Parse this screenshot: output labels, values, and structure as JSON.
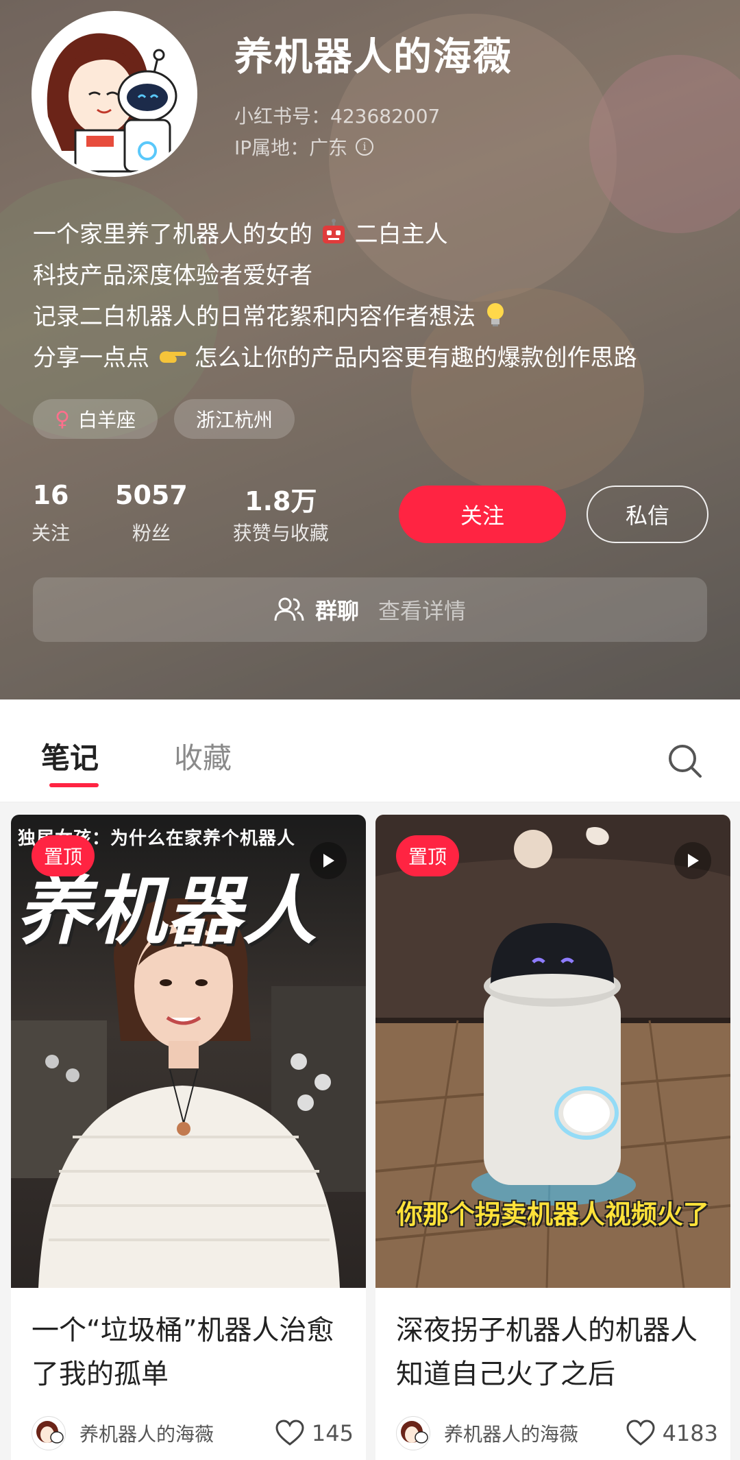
{
  "profile": {
    "nickname": "养机器人的海薇",
    "red_id": "小红书号：423682007",
    "ip_location": "IP属地：广东",
    "bio": [
      "一个家里养了机器人的女的",
      "二白主人",
      "科技产品深度体验者爱好者",
      "记录二白机器人的日常花絮和内容作者想法",
      "分享一点点",
      "怎么让你的产品内容更有趣的爆款创作思路"
    ],
    "tags": [
      "白羊座",
      "浙江杭州"
    ],
    "stats": [
      {
        "value": "16",
        "label": "关注"
      },
      {
        "value": "5057",
        "label": "粉丝"
      },
      {
        "value": "1.8万",
        "label": "获赞与收藏"
      }
    ],
    "follow_label": "关注",
    "message_label": "私信",
    "group_label": "群聊",
    "group_detail": "查看详情"
  },
  "tabs": {
    "notes": "笔记",
    "collect": "收藏"
  },
  "notes": [
    {
      "pinned_label": "置顶",
      "cover_top_text": "独居女孩：为什么在家养个机器人",
      "cover_big_text": "养机器人",
      "title": "一个“垃圾桶”机器人治愈了我的孤单",
      "author": "养机器人的海薇",
      "likes": "145"
    },
    {
      "pinned_label": "置顶",
      "cover_caption": "你那个拐卖机器人视频火了",
      "title": "深夜拐子机器人的机器人知道自己火了之后",
      "author": "养机器人的海薇",
      "likes": "4183"
    }
  ],
  "colors": {
    "accent": "#ff2442",
    "header_bg": "#8d7d74"
  },
  "icons": [
    "info-icon",
    "female-icon",
    "group-icon",
    "search-icon",
    "play-icon",
    "heart-icon",
    "robot-emoji",
    "bulb-emoji",
    "pointing-hand-emoji"
  ]
}
